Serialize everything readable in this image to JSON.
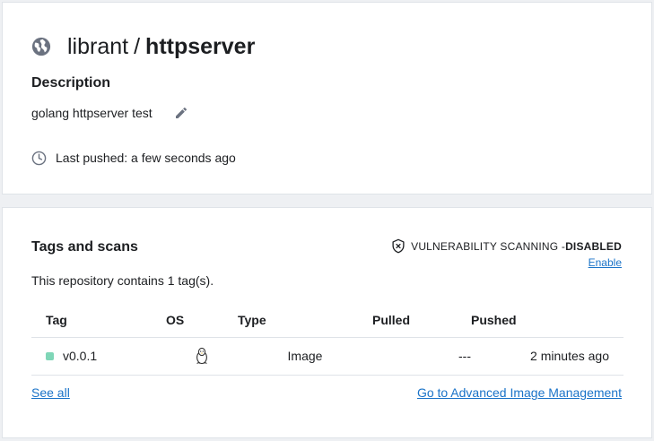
{
  "repo": {
    "namespace": "librant",
    "separator": "/",
    "name": "httpserver",
    "description_heading": "Description",
    "description": "golang httpserver test",
    "last_pushed": "Last pushed: a few seconds ago"
  },
  "tags_section": {
    "heading": "Tags and scans",
    "vuln_label": "VULNERABILITY SCANNING - ",
    "vuln_state": "DISABLED",
    "enable_label": "Enable",
    "count_text": "This repository contains 1 tag(s).",
    "columns": [
      "Tag",
      "OS",
      "Type",
      "Pulled",
      "Pushed"
    ],
    "rows": [
      {
        "tag": "v0.0.1",
        "os": "linux-icon",
        "type": "Image",
        "pulled": "---",
        "pushed": "2 minutes ago"
      }
    ],
    "see_all": "See all",
    "advanced_link": "Go to Advanced Image Management"
  },
  "colors": {
    "link": "#1a73c8",
    "tag_status": "#7fd6b7",
    "icon_gray": "#6b7280"
  },
  "icons": {
    "visibility": "globe-icon",
    "edit": "pencil-icon",
    "time": "clock-icon",
    "scan": "shield-x-icon"
  }
}
